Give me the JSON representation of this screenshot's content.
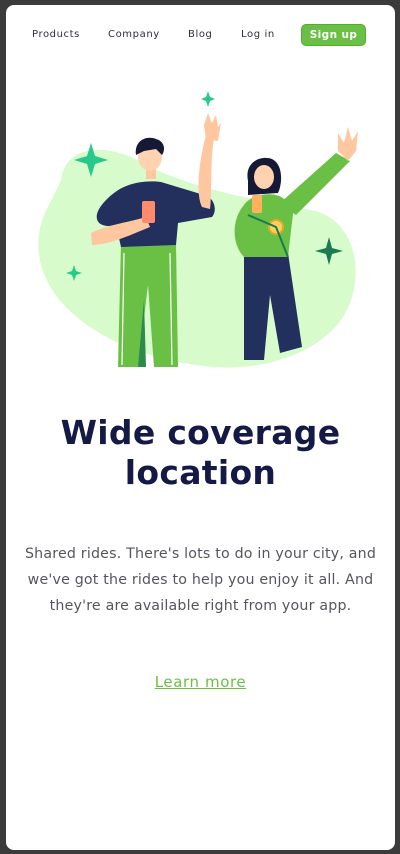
{
  "nav": {
    "products": "Products",
    "company": "Company",
    "blog": "Blog",
    "login": "Log in",
    "signup": "Sign up"
  },
  "hero": {
    "title_line1": "Wide coverage",
    "title_line2": "location",
    "description": "Shared rides. There's lots to do in your city, and we've got the rides to help you enjoy it all. And they're are available right from your app.",
    "cta": "Learn more"
  },
  "colors": {
    "accent": "#6abf45",
    "title": "#141a45",
    "blob": "#d8fbcc",
    "sparkle": "#27c98a"
  }
}
